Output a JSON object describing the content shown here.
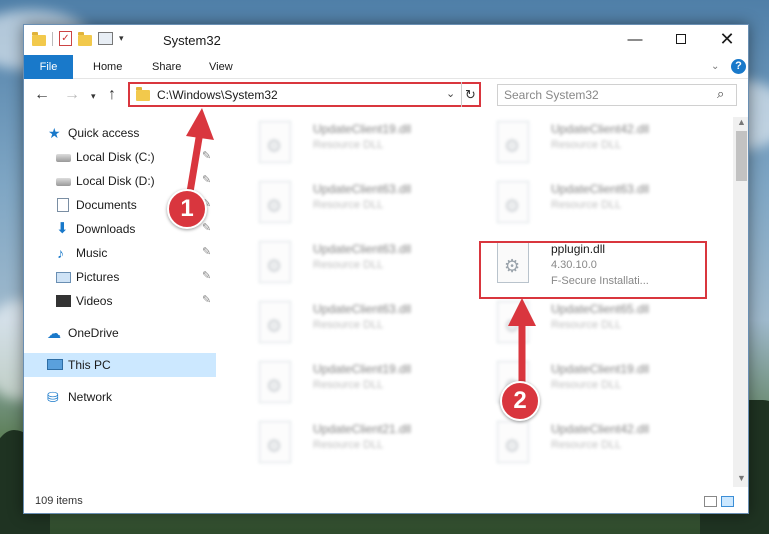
{
  "window": {
    "title": "System32",
    "controls": {
      "minimize": "—",
      "close": "✕"
    }
  },
  "ribbon": {
    "tabs": [
      "File",
      "Home",
      "Share",
      "View"
    ]
  },
  "navigation": {
    "address": "C:\\Windows\\System32",
    "search_placeholder": "Search System32"
  },
  "sidebar": {
    "items": [
      {
        "label": "Quick access",
        "icon": "star-icon"
      },
      {
        "label": "Local Disk (C:)",
        "icon": "drive-icon",
        "pinned": true
      },
      {
        "label": "Local Disk (D:)",
        "icon": "drive-icon",
        "pinned": true
      },
      {
        "label": "Documents",
        "icon": "documents-icon",
        "pinned": true
      },
      {
        "label": "Downloads",
        "icon": "download-icon",
        "pinned": true
      },
      {
        "label": "Music",
        "icon": "music-icon",
        "pinned": true
      },
      {
        "label": "Pictures",
        "icon": "pictures-icon",
        "pinned": true
      },
      {
        "label": "Videos",
        "icon": "videos-icon",
        "pinned": true
      },
      {
        "label": "OneDrive",
        "icon": "cloud-icon"
      },
      {
        "label": "This PC",
        "icon": "computer-icon",
        "selected": true
      },
      {
        "label": "Network",
        "icon": "network-icon"
      }
    ]
  },
  "files": [
    {
      "name": "UpdateClient19.dll",
      "type": "Resource DLL",
      "blurred": true
    },
    {
      "name": "UpdateClient42.dll",
      "type": "Resource DLL",
      "blurred": true
    },
    {
      "name": "UpdateClient63.dll",
      "type": "Resource DLL",
      "blurred": true
    },
    {
      "name": "UpdateClient63.dll",
      "type": "Resource DLL",
      "blurred": true
    },
    {
      "name": "UpdateClient63.dll",
      "type": "Resource DLL",
      "blurred": true
    },
    {
      "name": "pplugin.dll",
      "version": "4.30.10.0",
      "company": "F-Secure Installati...",
      "blurred": false,
      "highlighted": true
    },
    {
      "name": "UpdateClient63.dll",
      "type": "Resource DLL",
      "blurred": true
    },
    {
      "name": "UpdateClient65.dll",
      "type": "Resource DLL",
      "blurred": true
    },
    {
      "name": "UpdateClient19.dll",
      "type": "Resource DLL",
      "blurred": true
    },
    {
      "name": "UpdateClient19.dll",
      "type": "Resource DLL",
      "blurred": true
    },
    {
      "name": "UpdateClient21.dll",
      "type": "Resource DLL",
      "blurred": true
    },
    {
      "name": "UpdateClient42.dll",
      "type": "Resource DLL",
      "blurred": true
    }
  ],
  "status": {
    "item_count": "109 items"
  },
  "annotations": {
    "step1": "1",
    "step2": "2",
    "color": "#d9363e"
  }
}
